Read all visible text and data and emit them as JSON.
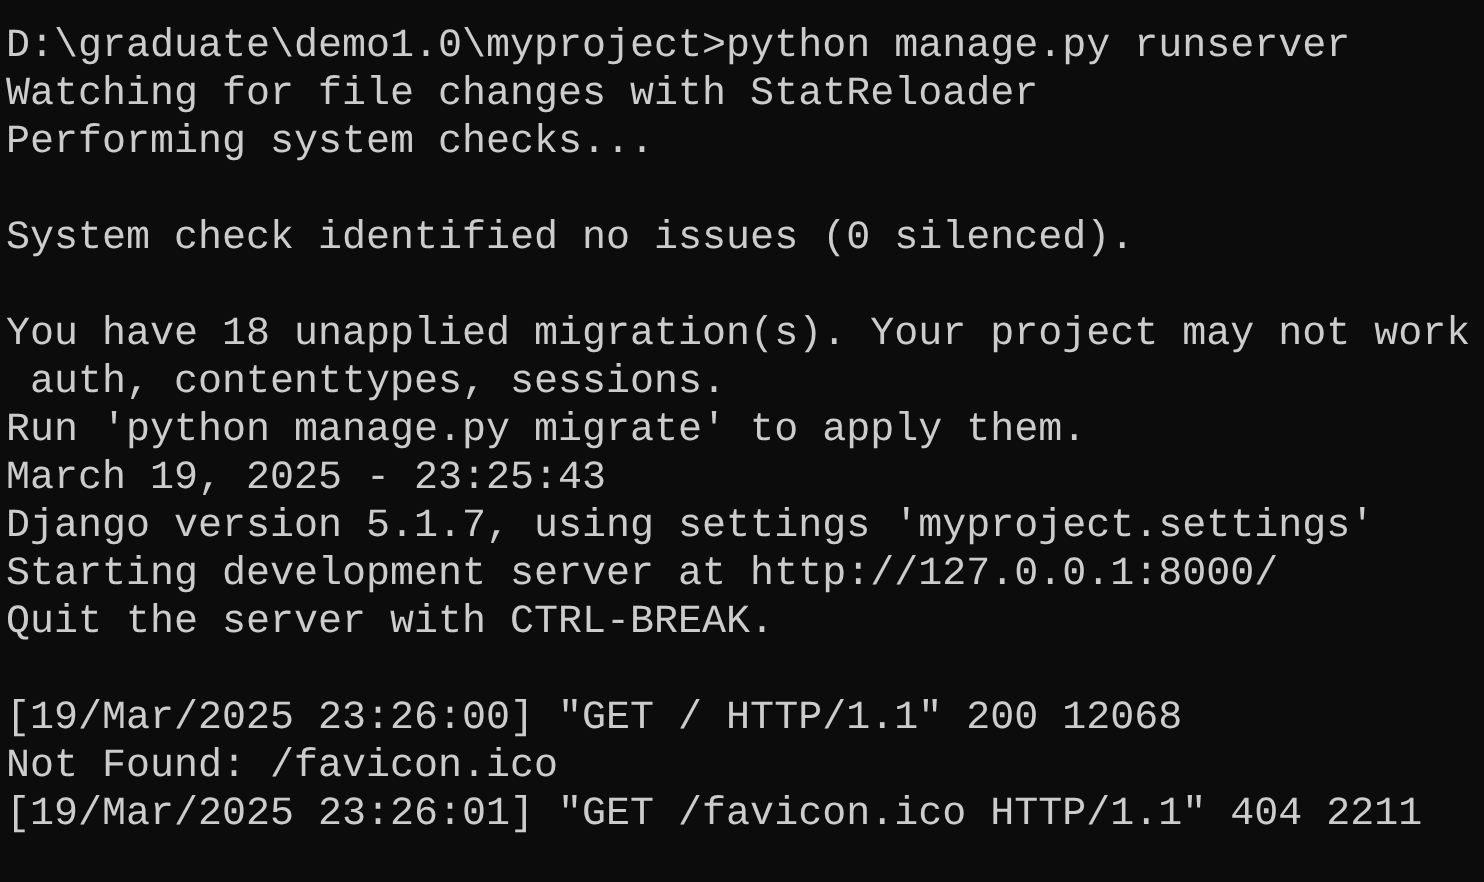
{
  "console": {
    "blocks": [
      {
        "lines": [
          "D:\\graduate\\demo1.0\\myproject>python manage.py runserver",
          "Watching for file changes with StatReloader",
          "Performing system checks..."
        ]
      },
      {
        "lines": [
          "System check identified no issues (0 silenced)."
        ]
      },
      {
        "lines": [
          "You have 18 unapplied migration(s). Your project may not work",
          " auth, contenttypes, sessions.",
          "Run 'python manage.py migrate' to apply them.",
          "March 19, 2025 - 23:25:43",
          "Django version 5.1.7, using settings 'myproject.settings'",
          "Starting development server at http://127.0.0.1:8000/",
          "Quit the server with CTRL-BREAK."
        ]
      },
      {
        "lines": [
          "[19/Mar/2025 23:26:00] \"GET / HTTP/1.1\" 200 12068",
          "Not Found: /favicon.ico",
          "[19/Mar/2025 23:26:01] \"GET /favicon.ico HTTP/1.1\" 404 2211"
        ]
      }
    ]
  }
}
